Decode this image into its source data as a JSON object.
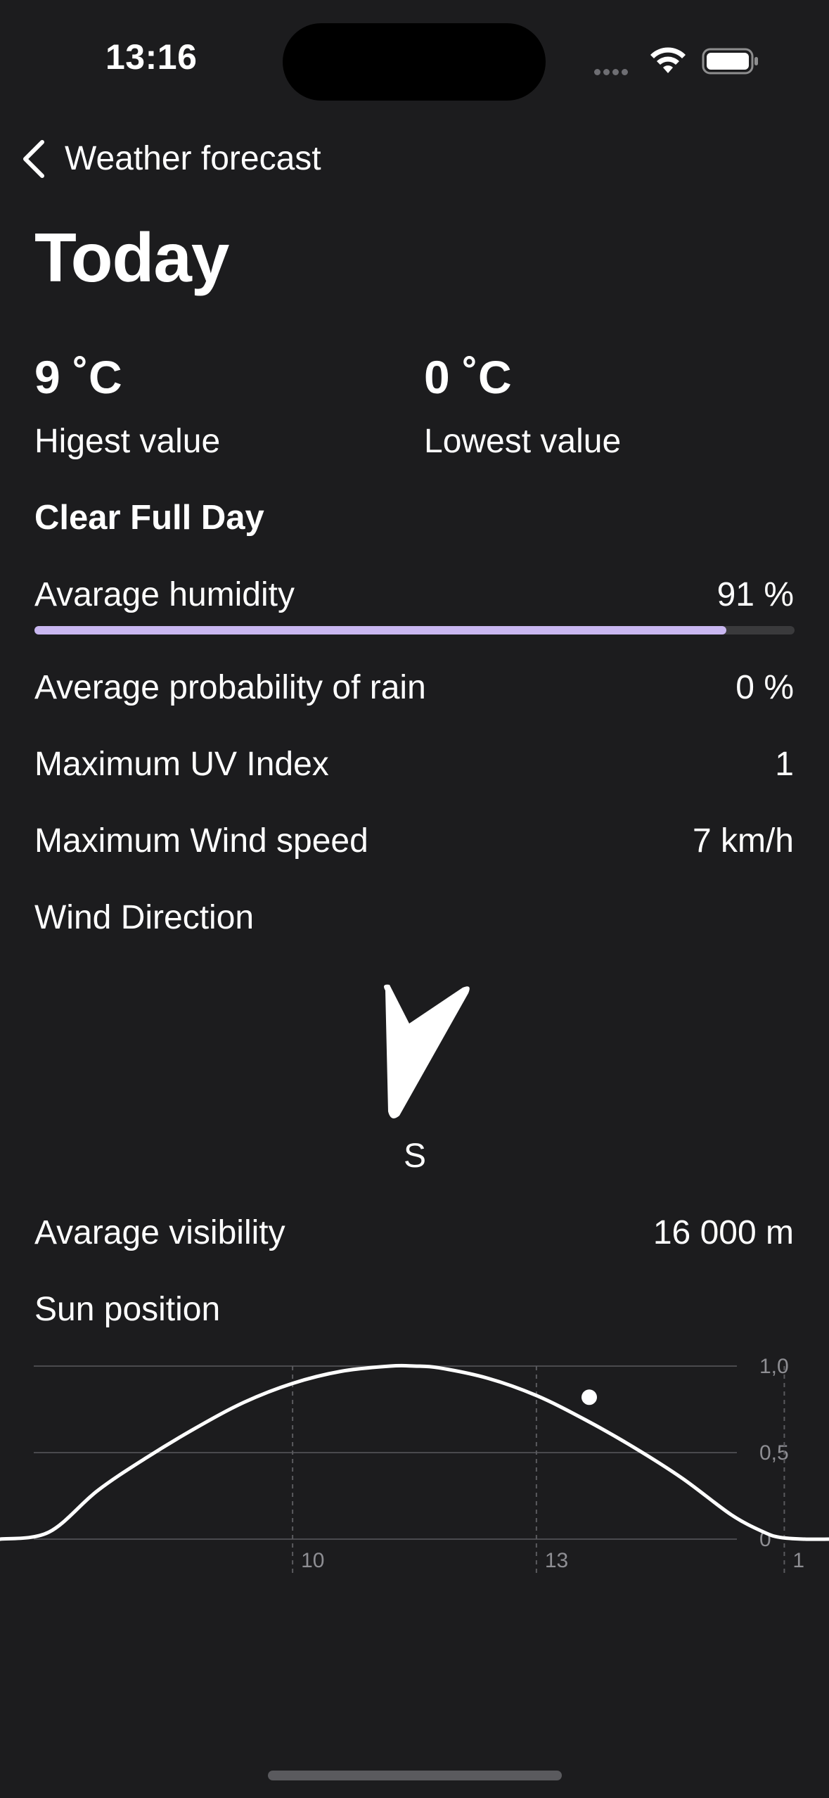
{
  "status_bar": {
    "time": "13:16"
  },
  "nav": {
    "back_label": "Weather forecast"
  },
  "page": {
    "title": "Today"
  },
  "temperatures": {
    "high": {
      "value": "9 ˚C",
      "label": "Higest value"
    },
    "low": {
      "value": "0 ˚C",
      "label": "Lowest value"
    }
  },
  "condition": "Clear Full Day",
  "humidity": {
    "label": "Avarage humidity",
    "value": "91 %",
    "fraction": 0.91,
    "color": "#c9b7f1"
  },
  "rows": {
    "rain": {
      "label": "Average probability of rain",
      "value": "0 %"
    },
    "uv": {
      "label": "Maximum UV Index",
      "value": "1"
    },
    "wind": {
      "label": "Maximum Wind speed",
      "value": "7 km/h"
    },
    "visibility": {
      "label": "Avarage visibility",
      "value": "16 000 m"
    }
  },
  "wind_direction": {
    "label": "Wind Direction",
    "value": "S",
    "icon": "navigation-arrow-icon"
  },
  "sun_position": {
    "label": "Sun position"
  },
  "chart_data": {
    "type": "line",
    "title": "",
    "x_ticks": [
      "10",
      "13",
      "1"
    ],
    "y_ticks": [
      "1,0",
      "0,5",
      "0"
    ],
    "ylim": [
      0,
      1
    ],
    "xlim": [
      6.4,
      16.6
    ],
    "series": [
      {
        "x": [
          6.4,
          7.0,
          7.6,
          8.2,
          8.8,
          9.4,
          10.0,
          10.6,
          11.2,
          11.5,
          11.8,
          12.4,
          13.0,
          13.6,
          14.2,
          14.8,
          15.4,
          15.8,
          16.0,
          16.3,
          16.6
        ],
        "y": [
          0.0,
          0.04,
          0.28,
          0.47,
          0.64,
          0.79,
          0.9,
          0.97,
          1.0,
          1.0,
          0.99,
          0.93,
          0.83,
          0.69,
          0.53,
          0.35,
          0.14,
          0.04,
          0.01,
          0.0,
          0.0
        ]
      }
    ],
    "marker": {
      "x": 13.65,
      "y": 0.82
    }
  }
}
